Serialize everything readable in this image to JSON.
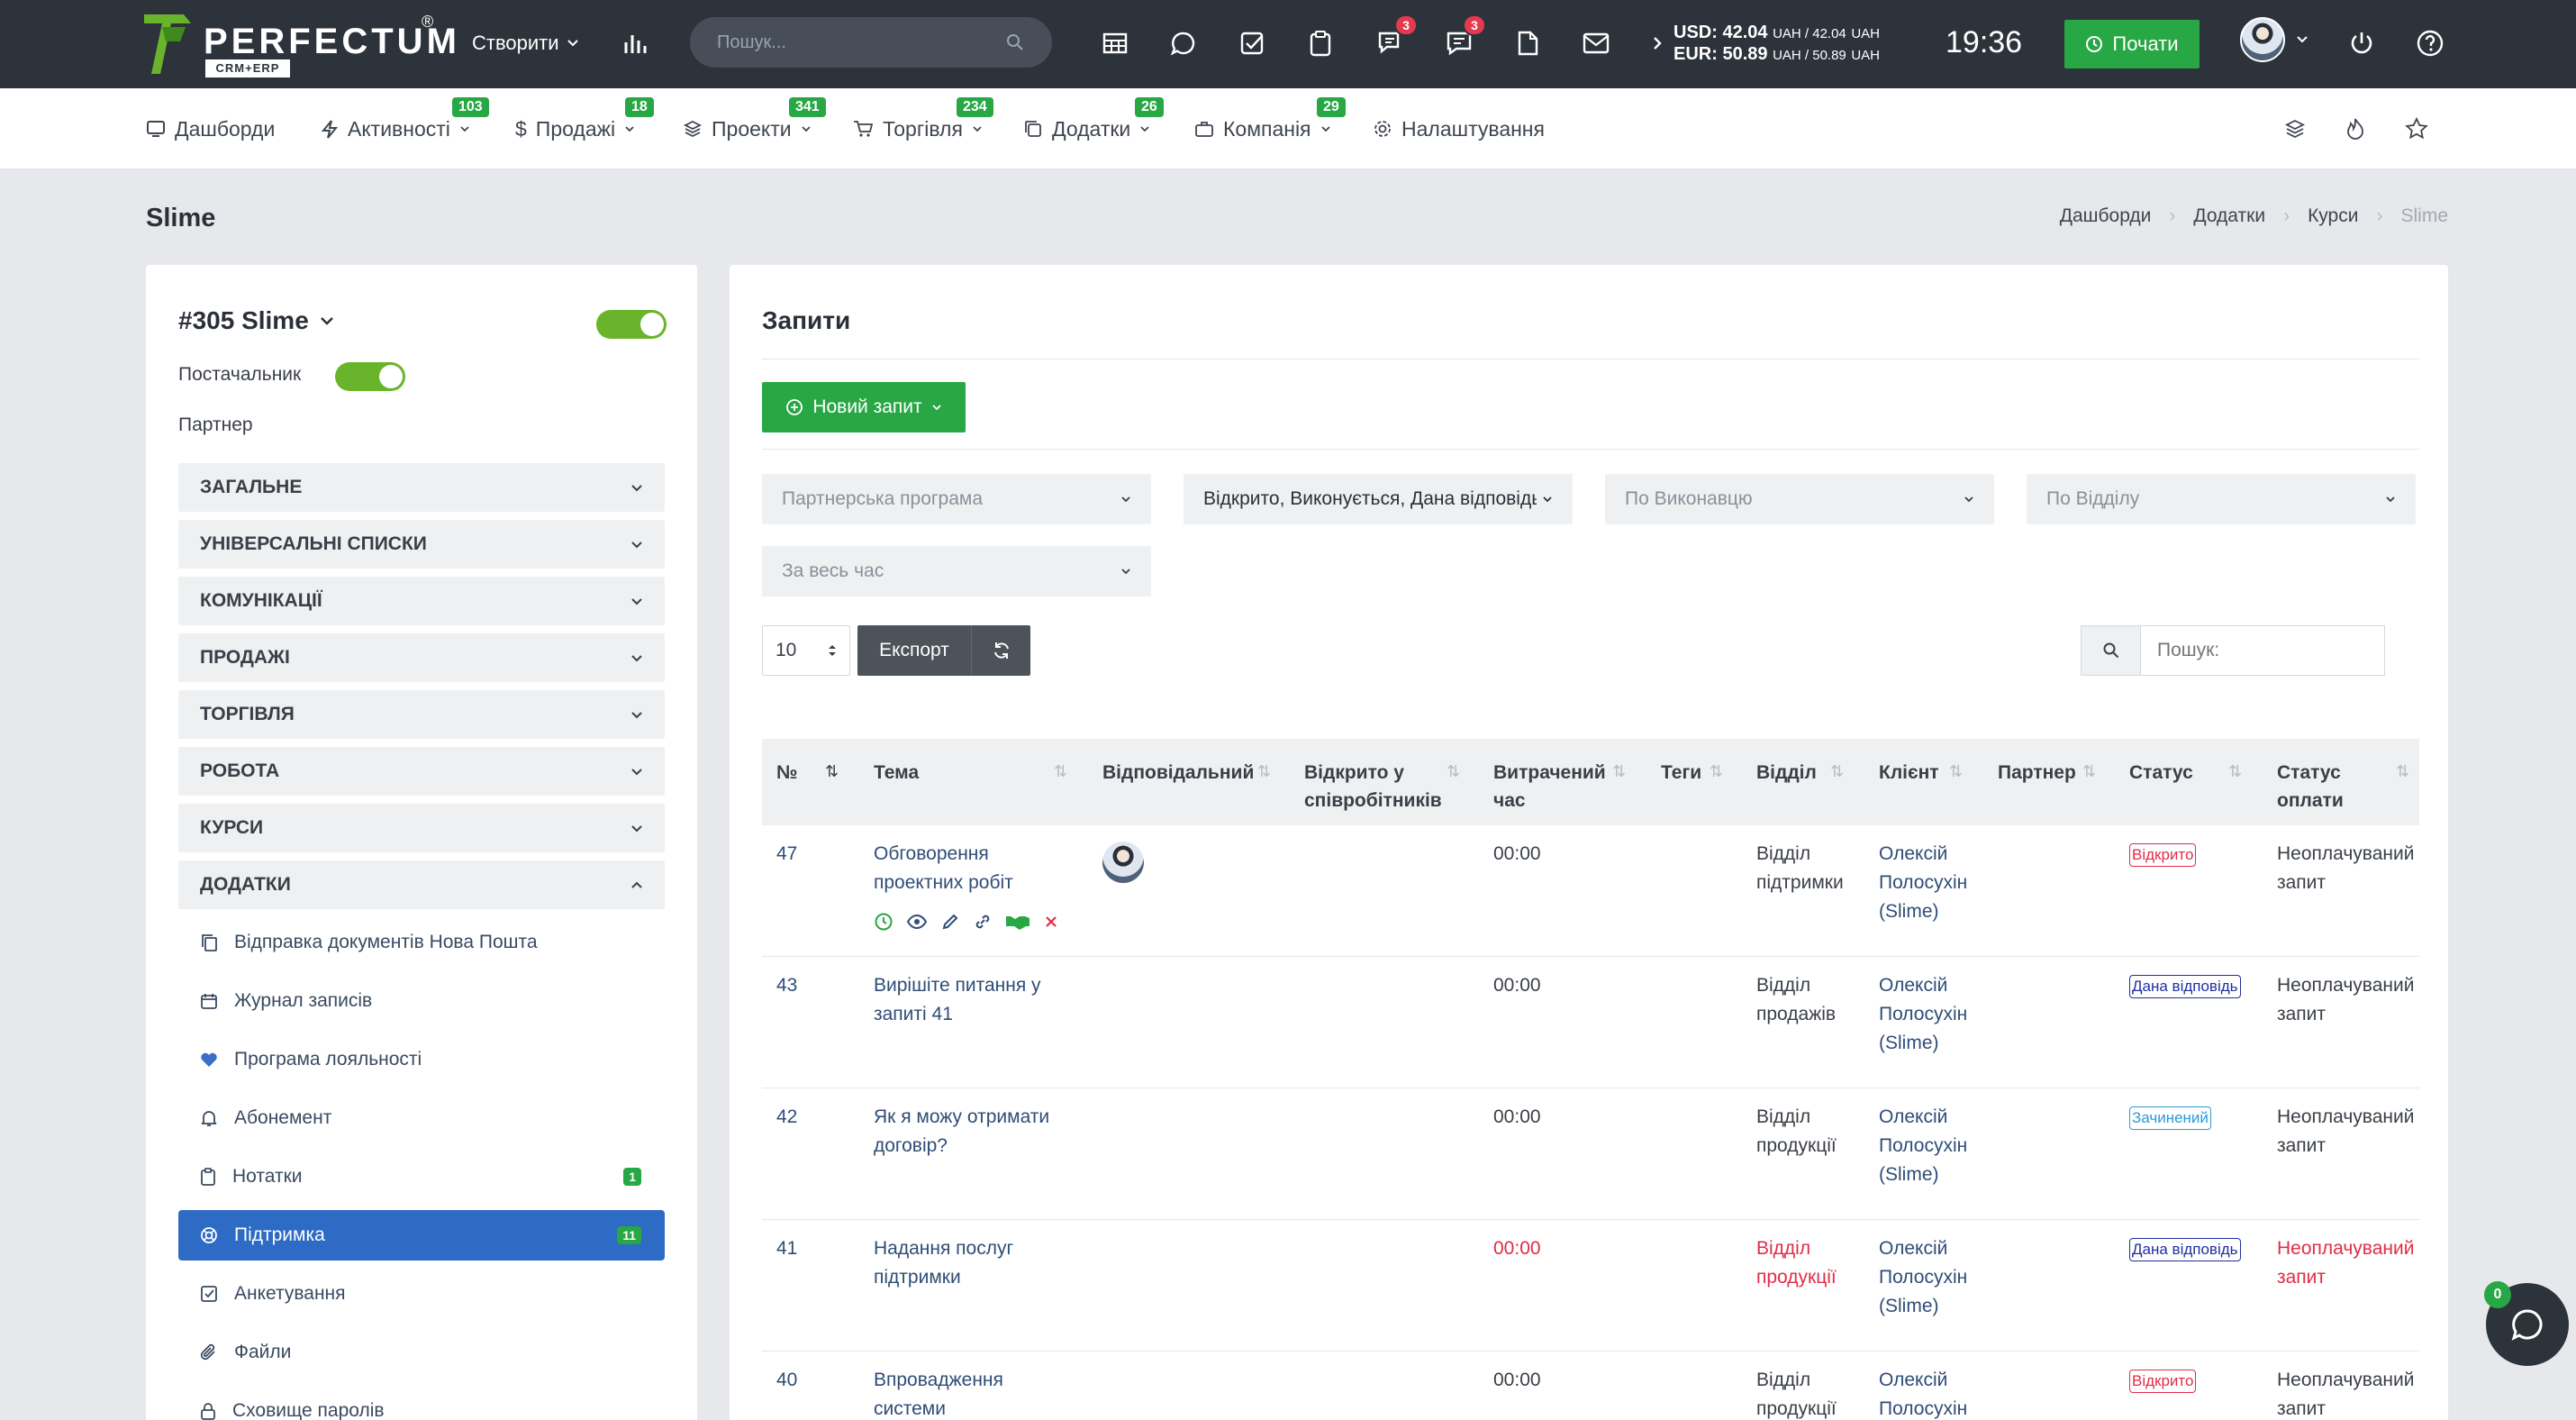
{
  "topbar": {
    "logo_text": "PERFECTUM",
    "logo_sub": "CRM+ERP",
    "logo_reg": "®",
    "create_label": "Створити",
    "search_placeholder": "Пошук...",
    "badges": {
      "chat": "3",
      "messages": "3"
    },
    "usd_line": "USD: 42.04",
    "usd_tail": "UAH / 42.04",
    "usd_unit": "UAH",
    "eur_line": "EUR: 50.89",
    "eur_tail": "UAH / 50.89",
    "eur_unit": "UAH",
    "time": "19:36",
    "start_label": "Почати"
  },
  "nav": {
    "items": [
      {
        "label": "Дашборди",
        "icon": "dashboard-icon"
      },
      {
        "label": "Активності",
        "badge": "103",
        "icon": "bolt-icon"
      },
      {
        "label": "Продажі",
        "badge": "18",
        "icon": "dollar-icon"
      },
      {
        "label": "Проекти",
        "badge": "341",
        "icon": "layers-icon"
      },
      {
        "label": "Торгівля",
        "badge": "234",
        "icon": "cart-icon"
      },
      {
        "label": "Додатки",
        "badge": "26",
        "icon": "copy-icon"
      },
      {
        "label": "Компанія",
        "badge": "29",
        "icon": "briefcase-icon"
      },
      {
        "label": "Налаштування",
        "icon": "gear-icon"
      }
    ]
  },
  "page": {
    "title": "Slime",
    "breadcrumb": [
      "Дашборди",
      "Додатки",
      "Курси",
      "Slime"
    ]
  },
  "left": {
    "record_title": "#305 Slime",
    "supplier_label": "Постачальник",
    "partner_label": "Партнер",
    "sections": [
      "ЗАГАЛЬНЕ",
      "УНІВЕРСАЛЬНІ СПИСКИ",
      "КОМУНІКАЦІЇ",
      "ПРОДАЖІ",
      "ТОРГІВЛЯ",
      "РОБОТА",
      "КУРСИ",
      "ДОДАТКИ"
    ],
    "subitems": [
      {
        "label": "Відправка документів Нова Пошта"
      },
      {
        "label": "Журнал записів"
      },
      {
        "label": "Програма лояльності"
      },
      {
        "label": "Абонемент"
      },
      {
        "label": "Нотатки",
        "badge": "1"
      },
      {
        "label": "Підтримка",
        "badge": "11",
        "active": true
      },
      {
        "label": "Анкетування"
      },
      {
        "label": "Файли"
      },
      {
        "label": "Сховище паролів"
      }
    ]
  },
  "main": {
    "title": "Запити",
    "new_button": "Новий запит",
    "filters": {
      "partner_program": "Партнерська програма",
      "status": "Відкрито, Виконується, Дана відповідь",
      "by_executor": "По Виконавцю",
      "by_department": "По Відділу",
      "period": "За весь час"
    },
    "page_size": "10",
    "export_label": "Експорт",
    "search_placeholder": "Пошук:",
    "columns": [
      "№",
      "Тема",
      "Відповідальний",
      "Відкрито у співробітників",
      "Витрачений час",
      "Теги",
      "Відділ",
      "Клієнт",
      "Партнер",
      "Статус",
      "Статус оплати"
    ],
    "rows": [
      {
        "num": "47",
        "topic": "Обговорення проектних робіт",
        "has_avatar": true,
        "time": "00:00",
        "dept": "Відділ підтримки",
        "client": "Олексій Полосухін (Slime)",
        "status": "Відкрито",
        "status_color": "#e02d47",
        "payment": "Неоплачуваний запит",
        "highlight": false
      },
      {
        "num": "43",
        "topic": "Вирішіте питання у запиті 41",
        "has_avatar": false,
        "time": "00:00",
        "dept": "Відділ продажів",
        "client": "Олексій Полосухін (Slime)",
        "status": "Дана відповідь",
        "status_color": "#1f2fa0",
        "payment": "Неоплачуваний запит",
        "highlight": false
      },
      {
        "num": "42",
        "topic": "Як я можу отримати договір?",
        "has_avatar": false,
        "time": "00:00",
        "dept": "Відділ продукції",
        "client": "Олексій Полосухін (Slime)",
        "status": "Зачинений",
        "status_color": "#2b9bd6",
        "payment": "Неоплачуваний запит",
        "highlight": false
      },
      {
        "num": "41",
        "topic": "Надання послуг підтримки",
        "has_avatar": false,
        "time": "00:00",
        "dept": "Відділ продукції",
        "client": "Олексій Полосухін (Slime)",
        "status": "Дана відповідь",
        "status_color": "#1f2fa0",
        "payment": "Неоплачуваний запит",
        "highlight": true
      },
      {
        "num": "40",
        "topic": "Впровадження системи",
        "has_avatar": false,
        "time": "00:00",
        "dept": "Відділ продукції",
        "client": "Олексій Полосухін",
        "status": "Відкрито",
        "status_color": "#e02d47",
        "payment": "Неоплачуваний запит",
        "highlight": false
      }
    ]
  },
  "chat": {
    "count": "0"
  }
}
